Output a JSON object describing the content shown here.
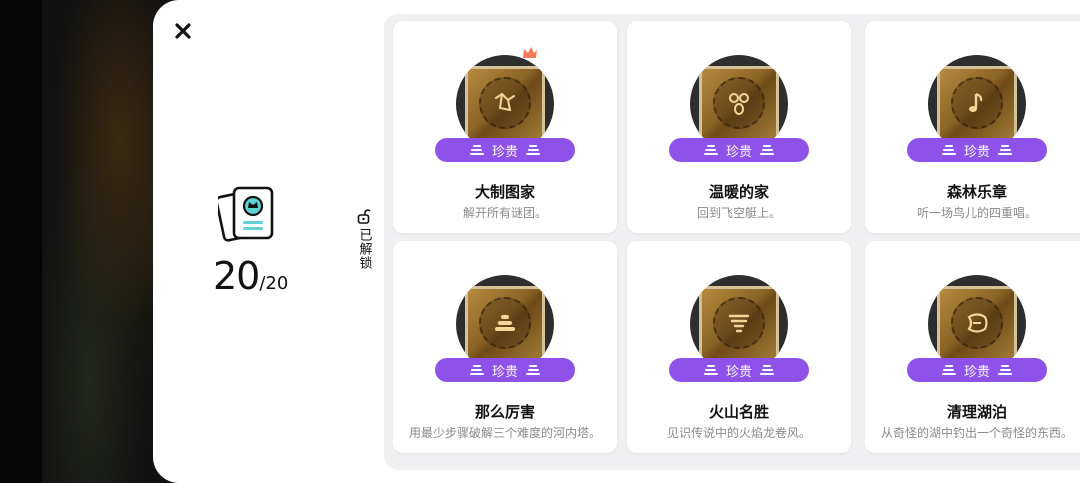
{
  "summary": {
    "count_current": "20",
    "count_total": "/20",
    "unlocked_label": "已解锁"
  },
  "colors": {
    "rarity_purple": "#8e52ea",
    "panel_bg": "#ffffff",
    "grid_bg": "#f0f0f2",
    "accent_teal": "#3f8f8f"
  },
  "icons": {
    "close": "close-icon",
    "summary": "achievement-cards-icon",
    "lock": "unlock-icon"
  },
  "achievements": [
    {
      "title": "大制图家",
      "desc": "解开所有谜团。",
      "rarity": "珍贵",
      "glyph": "map-constellation-icon",
      "new": true
    },
    {
      "title": "温暖的家",
      "desc": "回到飞空艇上。",
      "rarity": "珍贵",
      "glyph": "home-knot-icon",
      "new": false
    },
    {
      "title": "森林乐章",
      "desc": "听一场鸟儿的四重唱。",
      "rarity": "珍贵",
      "glyph": "music-note-icon",
      "new": false
    },
    {
      "title": "那么厉害",
      "desc": "用最少步骤破解三个难度的河内塔。",
      "rarity": "珍贵",
      "glyph": "hanoi-tower-icon",
      "new": false
    },
    {
      "title": "火山名胜",
      "desc": "见识传说中的火焰龙卷风。",
      "rarity": "珍贵",
      "glyph": "tornado-icon",
      "new": false
    },
    {
      "title": "清理湖泊",
      "desc": "从奇怪的湖中钓出一个奇怪的东西。",
      "rarity": "珍贵",
      "glyph": "fish-icon",
      "new": false
    }
  ]
}
